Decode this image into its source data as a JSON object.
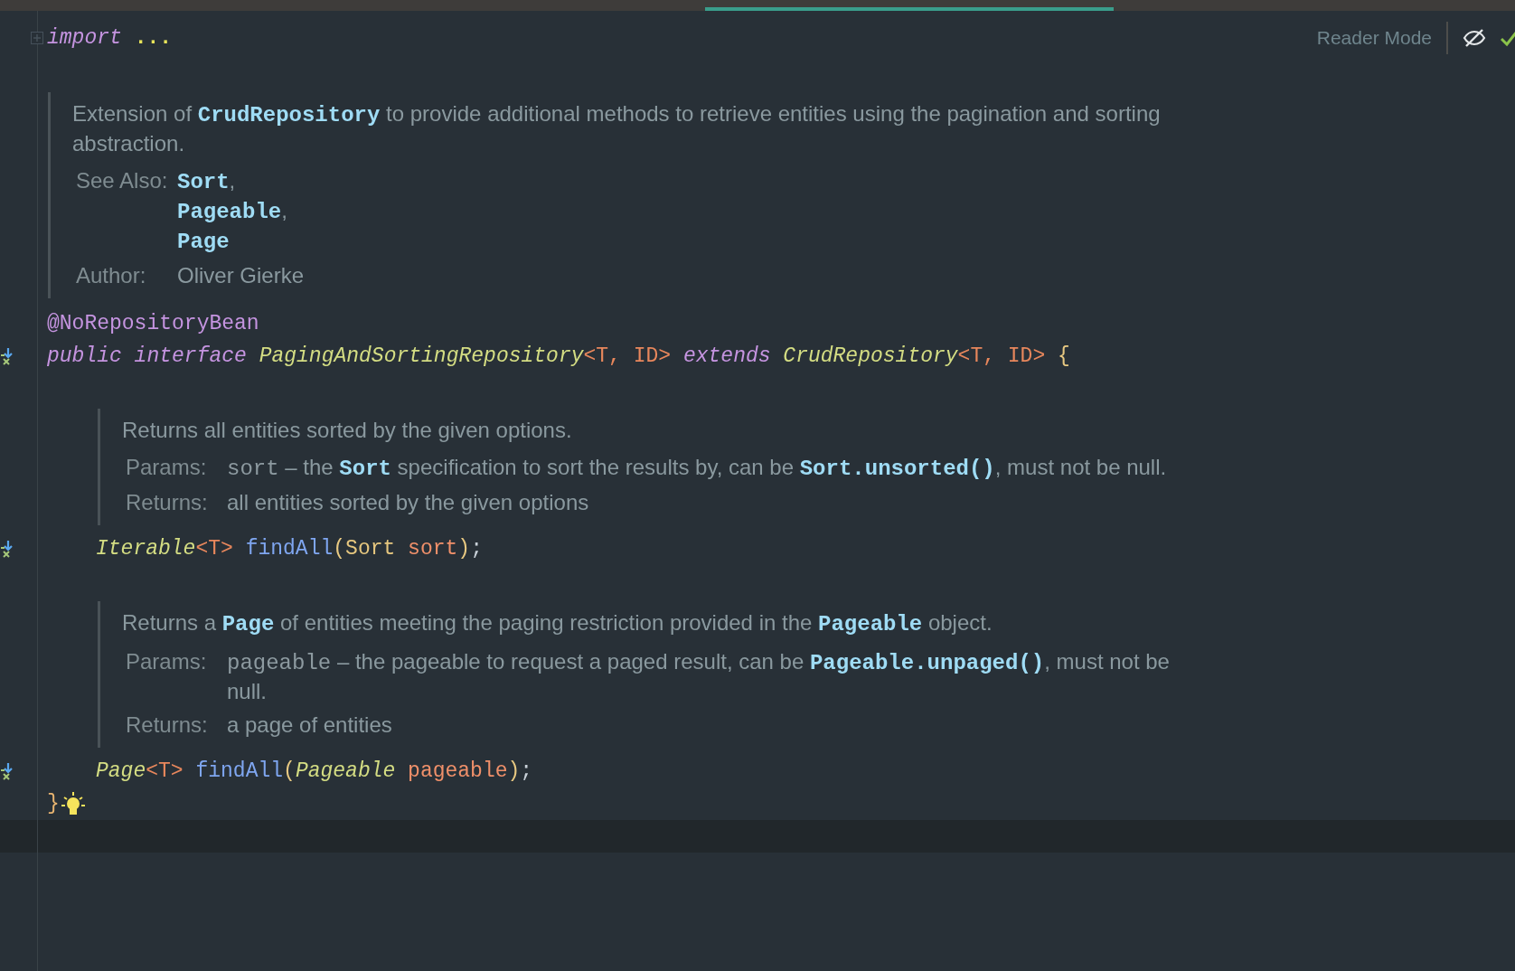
{
  "header": {
    "fold_keyword": "import",
    "fold_ellipsis": "...",
    "reader_mode": "Reader Mode"
  },
  "rows": [
    {
      "kind": "doc",
      "summary": [
        {
          "kind": "text",
          "text": "Extension of "
        },
        {
          "kind": "link",
          "text": "CrudRepository"
        },
        {
          "kind": "text",
          "text": " to provide additional methods to retrieve entities using the pagination and sorting abstraction."
        }
      ],
      "tags": [
        {
          "label": "See Also:",
          "values": [
            [
              {
                "kind": "link",
                "text": "Sort"
              },
              {
                "kind": "text",
                "text": ","
              }
            ],
            [
              {
                "kind": "link",
                "text": "Pageable"
              },
              {
                "kind": "text",
                "text": ","
              }
            ],
            [
              {
                "kind": "link",
                "text": "Page"
              }
            ]
          ]
        },
        {
          "label": "Author:",
          "values": [
            [
              {
                "kind": "text",
                "text": "Oliver Gierke"
              }
            ]
          ]
        }
      ]
    },
    {
      "kind": "code",
      "marker": false,
      "tokens": [
        {
          "kind": "annotation",
          "text": "@NoRepositoryBean"
        }
      ]
    },
    {
      "kind": "code",
      "marker": true,
      "tokens": [
        {
          "kind": "keyword",
          "text": "public interface "
        },
        {
          "kind": "iface",
          "text": "PagingAndSortingRepository"
        },
        {
          "kind": "typeparam",
          "text": "<T, ID> "
        },
        {
          "kind": "keyword",
          "text": "extends "
        },
        {
          "kind": "iface",
          "text": "CrudRepository"
        },
        {
          "kind": "typeparam",
          "text": "<T, ID> "
        },
        {
          "kind": "punct",
          "text": "{"
        }
      ],
      "body": [
        {
          "kind": "doc",
          "summary": [
            {
              "kind": "text",
              "text": "Returns all entities sorted by the given options."
            }
          ],
          "tags": [
            {
              "label": "Params:",
              "values": [
                [
                  {
                    "kind": "code",
                    "text": "sort"
                  },
                  {
                    "kind": "text",
                    "text": " – the "
                  },
                  {
                    "kind": "link",
                    "text": "Sort"
                  },
                  {
                    "kind": "text",
                    "text": " specification to sort the results by, can be "
                  },
                  {
                    "kind": "link",
                    "text": "Sort.unsorted()"
                  },
                  {
                    "kind": "text",
                    "text": ", must not be null."
                  }
                ]
              ]
            },
            {
              "label": "Returns:",
              "values": [
                [
                  {
                    "kind": "text",
                    "text": "all entities sorted by the given options"
                  }
                ]
              ]
            }
          ]
        },
        {
          "kind": "code",
          "marker": true,
          "tokens": [
            {
              "kind": "iface",
              "text": "Iterable"
            },
            {
              "kind": "typeparam",
              "text": "<T> "
            },
            {
              "kind": "method",
              "text": "findAll"
            },
            {
              "kind": "punct",
              "text": "("
            },
            {
              "kind": "class",
              "text": "Sort "
            },
            {
              "kind": "param",
              "text": "sort"
            },
            {
              "kind": "punct",
              "text": ")"
            },
            {
              "kind": "plain",
              "text": ";"
            }
          ]
        },
        {
          "kind": "doc",
          "summary": [
            {
              "kind": "text",
              "text": "Returns a "
            },
            {
              "kind": "link",
              "text": "Page"
            },
            {
              "kind": "text",
              "text": " of entities meeting the paging restriction provided in the "
            },
            {
              "kind": "link",
              "text": "Pageable"
            },
            {
              "kind": "text",
              "text": " object."
            }
          ],
          "tags": [
            {
              "label": "Params:",
              "values": [
                [
                  {
                    "kind": "code",
                    "text": "pageable"
                  },
                  {
                    "kind": "text",
                    "text": " – the pageable to request a paged result, can be "
                  },
                  {
                    "kind": "link",
                    "text": "Pageable.unpaged()"
                  },
                  {
                    "kind": "text",
                    "text": ", must not be null."
                  }
                ]
              ]
            },
            {
              "label": "Returns:",
              "values": [
                [
                  {
                    "kind": "text",
                    "text": "a page of entities"
                  }
                ]
              ]
            }
          ]
        },
        {
          "kind": "code",
          "marker": true,
          "tokens": [
            {
              "kind": "iface",
              "text": "Page"
            },
            {
              "kind": "typeparam",
              "text": "<T> "
            },
            {
              "kind": "method",
              "text": "findAll"
            },
            {
              "kind": "punct",
              "text": "("
            },
            {
              "kind": "iface",
              "text": "Pageable "
            },
            {
              "kind": "param",
              "text": "pageable"
            },
            {
              "kind": "punct",
              "text": ")"
            },
            {
              "kind": "plain",
              "text": ";"
            }
          ]
        }
      ]
    },
    {
      "kind": "code",
      "marker": false,
      "bulb": true,
      "tokens": [
        {
          "kind": "closing",
          "text": "}"
        }
      ]
    },
    {
      "kind": "current"
    }
  ]
}
